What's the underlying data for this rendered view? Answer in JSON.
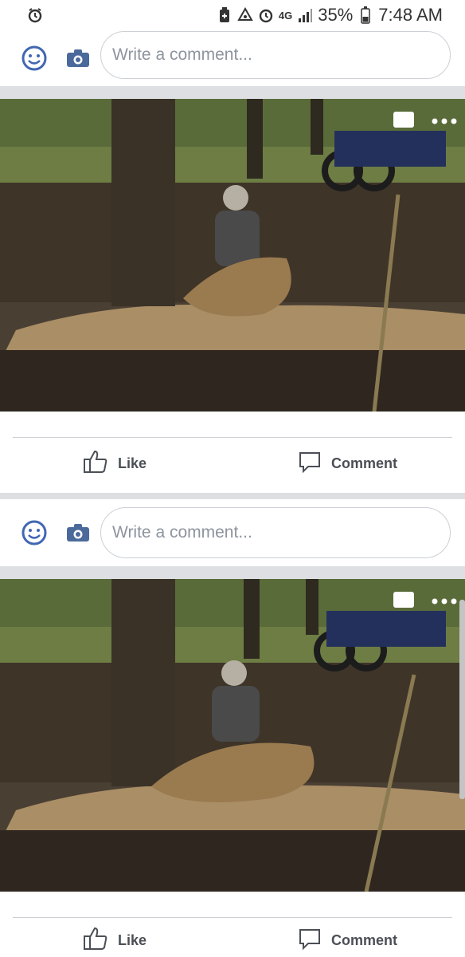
{
  "status_bar": {
    "battery_percent": "35%",
    "network": "4G",
    "time": "7:48 AM",
    "icons": [
      "alarm-icon",
      "battery-saver-icon",
      "recycle-icon",
      "alarm-icon",
      "signal-icon",
      "battery-icon"
    ]
  },
  "posts": [
    {
      "comment_placeholder": "Write a comment...",
      "photo_alt": "dirt bike rider splashing through mud",
      "actions": {
        "like": "Like",
        "comment": "Comment"
      }
    },
    {
      "comment_placeholder": "Write a comment...",
      "photo_alt": "dirt bike rider splashing through mud",
      "actions": {
        "like": "Like",
        "comment": "Comment"
      }
    }
  ],
  "colors": {
    "accent": "#4b4f56",
    "icon_blue": "#4267b2",
    "divider": "#ccd0d5",
    "background": "#dddfe2"
  }
}
